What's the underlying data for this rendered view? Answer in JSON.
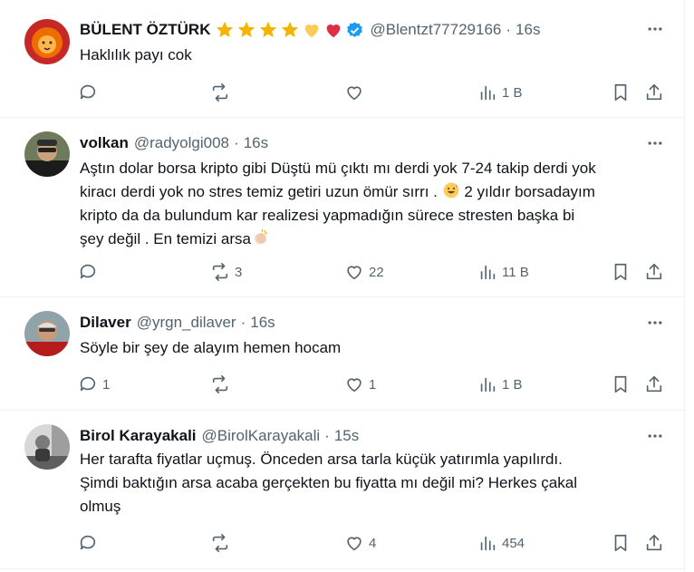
{
  "colors": {
    "text": "#0f1419",
    "secondary": "#536471",
    "divider": "#eff3f4",
    "verified": "#1d9bf0",
    "star": "#f4b400",
    "heart": "#dd2e44",
    "yellow_heart": "#fdcb58"
  },
  "tweets": [
    {
      "name": "BÜLENT ÖZTÜRK",
      "badges": [
        "star-emoji",
        "star-emoji",
        "star-emoji",
        "star-emoji",
        "yellow-heart-emoji",
        "red-heart-emoji",
        "verified-badge-icon"
      ],
      "handle": "@Blentzt77729166",
      "dot": "·",
      "time": "16s",
      "text": "Haklılık payı cok",
      "reply_count": "",
      "retweet_count": "",
      "like_count": "",
      "views": "1 B"
    },
    {
      "name": "volkan",
      "handle": "@radyolgi008",
      "dot": "·",
      "time": "16s",
      "text_lines": [
        "Aştın dolar borsa kripto gibi Düştü mü çıktı mı derdi yok 7-24 takip derdi yok",
        "kiracı derdi yok  no stres  temiz getiri uzun ömür sırrı . ",
        " 2 yıldır borsadayım",
        "kripto da da bulundum kar realizesi yapmadığın sürece stresten başka bi",
        "şey değil .  En temizi arsa"
      ],
      "emojis": [
        "grinning-sweat-emoji",
        "clapping-hands-emoji"
      ],
      "reply_count": "",
      "retweet_count": "3",
      "like_count": "22",
      "views": "11 B"
    },
    {
      "name": "Dilaver",
      "handle": "@yrgn_dilaver",
      "dot": "·",
      "time": "16s",
      "text": "Söyle bir şey de alayım hemen hocam",
      "reply_count": "1",
      "retweet_count": "",
      "like_count": "1",
      "views": "1 B"
    },
    {
      "name": "Birol Karayakali",
      "handle": "@BirolKarayakali",
      "dot": "·",
      "time": "15s",
      "text_lines": [
        "Her tarafta fiyatlar uçmuş. Önceden arsa tarla küçük yatırımla yapılırdı.",
        "Şimdi baktığın arsa acaba gerçekten bu fiyatta mı değil mi? Herkes çakal",
        "olmuş"
      ],
      "reply_count": "",
      "retweet_count": "",
      "like_count": "4",
      "views": "454"
    }
  ]
}
